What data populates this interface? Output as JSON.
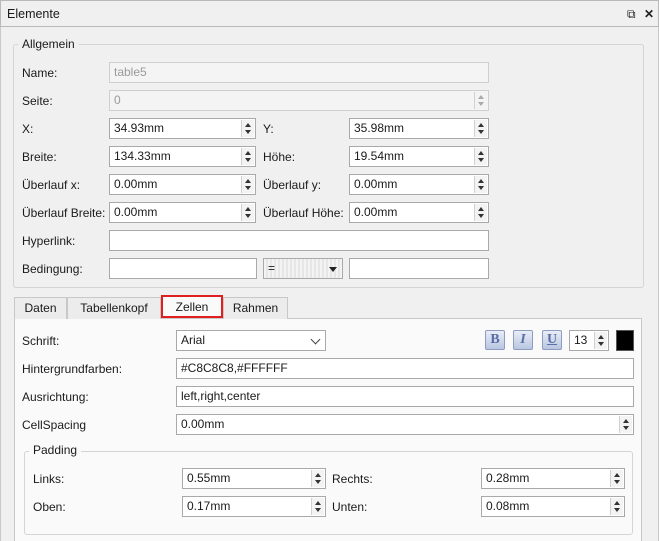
{
  "window": {
    "title": "Elemente",
    "restore_icon": "restore-icon",
    "close_icon": "close-icon"
  },
  "general": {
    "legend": "Allgemein",
    "name_label": "Name:",
    "name_value": "table5",
    "page_label": "Seite:",
    "page_value": "0",
    "x_label": "X:",
    "x_value": "34.93mm",
    "y_label": "Y:",
    "y_value": "35.98mm",
    "width_label": "Breite:",
    "width_value": "134.33mm",
    "height_label": "Höhe:",
    "height_value": "19.54mm",
    "overflow_x_label": "Überlauf x:",
    "overflow_x_value": "0.00mm",
    "overflow_y_label": "Überlauf y:",
    "overflow_y_value": "0.00mm",
    "overflow_width_label": "Überlauf Breite:",
    "overflow_width_value": "0.00mm",
    "overflow_height_label": "Überlauf Höhe:",
    "overflow_height_value": "0.00mm",
    "hyperlink_label": "Hyperlink:",
    "hyperlink_value": "",
    "condition_label": "Bedingung:",
    "condition_left": "",
    "condition_operator": "=",
    "condition_right": ""
  },
  "tabs": [
    {
      "label": "Daten"
    },
    {
      "label": "Tabellenkopf"
    },
    {
      "label": "Zellen"
    },
    {
      "label": "Rahmen"
    }
  ],
  "active_tab": "Zellen",
  "cells": {
    "font_label": "Schrift:",
    "font_value": "Arial",
    "bold": "B",
    "italic": "I",
    "underline": "U",
    "font_size": "13",
    "font_color": "#000000",
    "bg_label": "Hintergrundfarben:",
    "bg_value": "#C8C8C8,#FFFFFF",
    "align_label": "Ausrichtung:",
    "align_value": "left,right,center",
    "spacing_label": "CellSpacing",
    "spacing_value": "0.00mm",
    "padding": {
      "legend": "Padding",
      "left_label": "Links:",
      "left_value": "0.55mm",
      "right_label": "Rechts:",
      "right_value": "0.28mm",
      "top_label": "Oben:",
      "top_value": "0.17mm",
      "bottom_label": "Unten:",
      "bottom_value": "0.08mm"
    }
  },
  "colors": {
    "accent_highlight": "#e0201e",
    "field_border": "#a9a9a9"
  }
}
